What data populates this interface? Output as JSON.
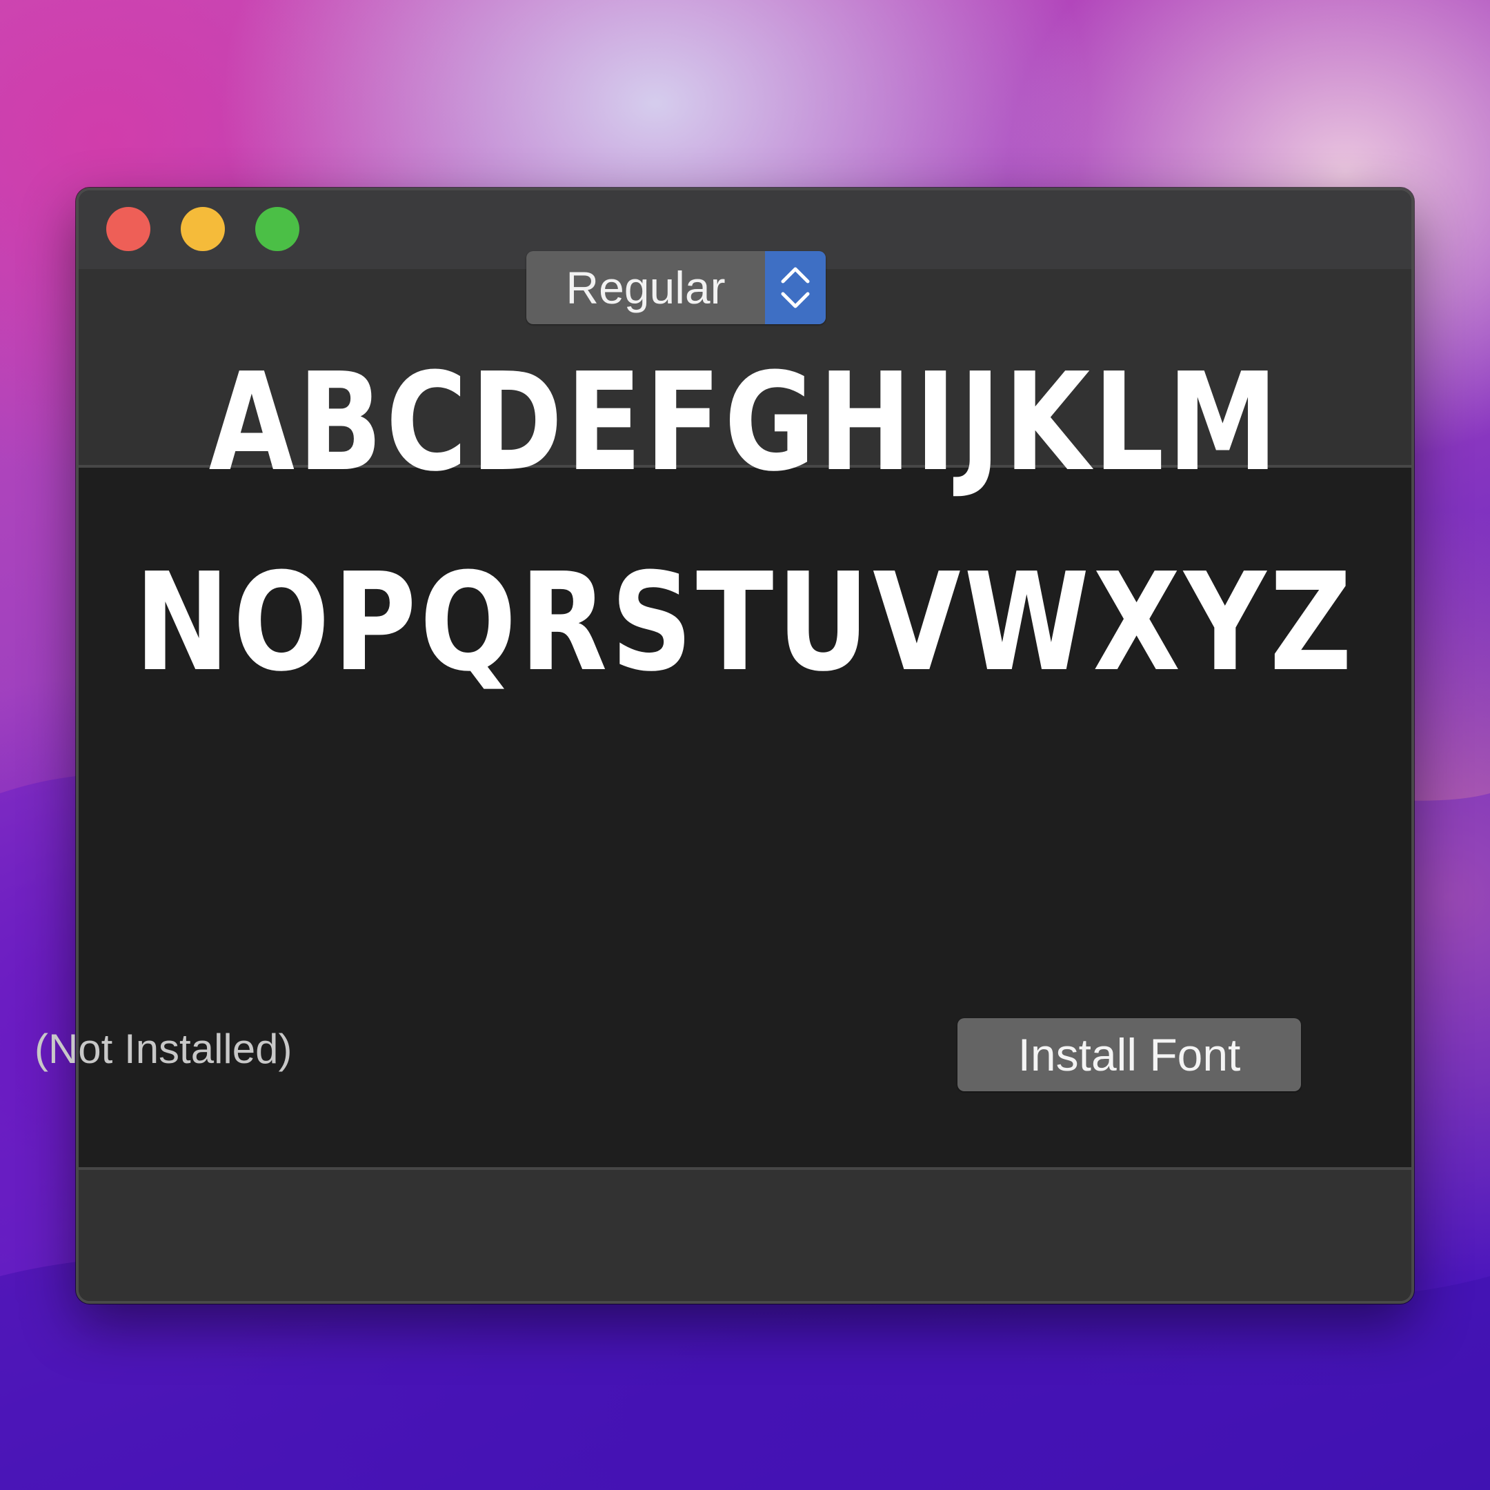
{
  "window": {
    "controls": [
      {
        "name": "close",
        "color": "#ee5f57"
      },
      {
        "name": "minimize",
        "color": "#f5bb3a"
      },
      {
        "name": "zoom",
        "color": "#4bbf46"
      }
    ]
  },
  "toolbar": {
    "style_select": {
      "value": "Regular",
      "stepper_icon": "chevron-up-down-icon",
      "accent_color": "#3e6fc4"
    }
  },
  "preview": {
    "line1": "ABCDEFGHIJKLM",
    "line2": "NOPQRSTUVWXYZ"
  },
  "footer": {
    "status": "(Not Installed)",
    "install_button": "Install Font"
  }
}
